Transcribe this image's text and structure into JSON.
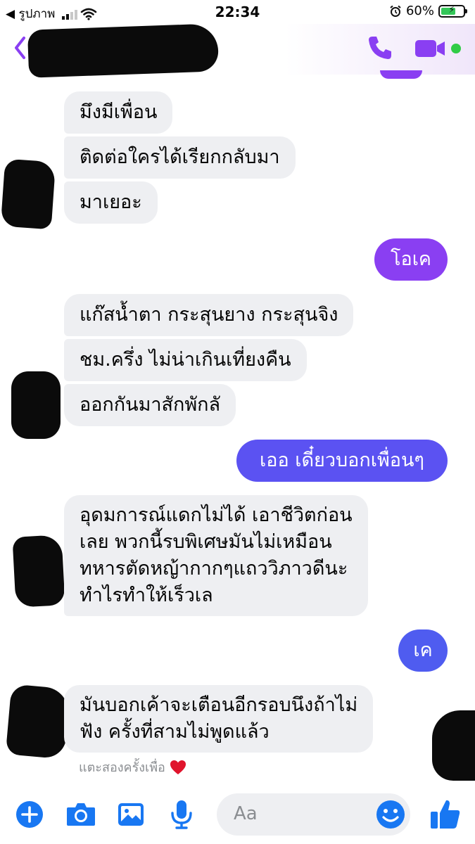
{
  "status_bar": {
    "back_app": "◀ รูปภาพ",
    "time": "22:34",
    "battery": "60%"
  },
  "header": {
    "contact_name": "",
    "accent_color": "#8a3ff2"
  },
  "messages": [
    {
      "side": "incoming",
      "text": "มึงมีเพื่อน"
    },
    {
      "side": "incoming",
      "text": "ติดต่อใครได้เรียกกลับมา"
    },
    {
      "side": "incoming",
      "text": "มาเยอะ"
    },
    {
      "side": "outgoing",
      "text": "โอเค"
    },
    {
      "side": "incoming",
      "text": "แก๊สน้ำตา กระสุนยาง กระสุนจิง"
    },
    {
      "side": "incoming",
      "text": "ชม.ครึ่ง ไม่น่าเกินเที่ยงคืน"
    },
    {
      "side": "incoming",
      "text": "ออกกันมาสักพักลั"
    },
    {
      "side": "outgoing",
      "text": "เออ เดี๋ยวบอกเพื่อนๆ"
    },
    {
      "side": "incoming",
      "lines": [
        "อุดมการณ์แดกไม่ได้ เอาชีวิตก่อน",
        "เลย พวกนี้รบพิเศษมันไม่เหมือน",
        "ทหารตัดหญ้ากากๆแถววิภาวดีนะ",
        "ทำไรทำให้เร็วเล"
      ]
    },
    {
      "side": "outgoing",
      "text": "เค"
    },
    {
      "side": "incoming",
      "lines": [
        "มันบอกเค้าจะเตือนอีกรอบนึงถ้าไม่",
        "ฟัง ครั้งที่สามไม่พูดแล้ว"
      ]
    }
  ],
  "reaction_hint": {
    "text": "แตะสองครั้งเพื่อ",
    "icon": "heart-icon"
  },
  "composer": {
    "placeholder": "Aa",
    "icons": [
      "plus-icon",
      "camera-icon",
      "image-icon",
      "microphone-icon",
      "emoji-icon",
      "thumbs-up-icon"
    ]
  },
  "colors": {
    "incoming_bg": "#eeeff2",
    "outgoing_purple": "#8a3ff2",
    "outgoing_blue": "#4f5cf0",
    "icon_blue": "#1877f2"
  }
}
